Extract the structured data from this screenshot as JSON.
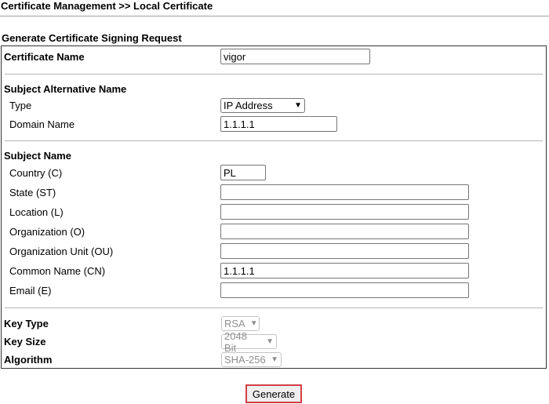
{
  "breadcrumb": "Certificate Management >> Local Certificate",
  "section_title": "Generate Certificate Signing Request",
  "certificate_name": {
    "label": "Certificate Name",
    "value": "vigor"
  },
  "san": {
    "heading": "Subject Alternative Name",
    "type_label": "Type",
    "type_value": "IP Address",
    "domain_label": "Domain Name",
    "domain_value": "1.1.1.1"
  },
  "subject": {
    "heading": "Subject Name",
    "country_label": "Country (C)",
    "country_value": "PL",
    "state_label": "State (ST)",
    "state_value": "",
    "location_label": "Location (L)",
    "location_value": "",
    "org_label": "Organization (O)",
    "org_value": "",
    "ou_label": "Organization Unit (OU)",
    "ou_value": "",
    "cn_label": "Common Name (CN)",
    "cn_value": "1.1.1.1",
    "email_label": "Email (E)",
    "email_value": ""
  },
  "key": {
    "type_label": "Key Type",
    "type_value": "RSA",
    "size_label": "Key Size",
    "size_value": "2048 Bit",
    "algo_label": "Algorithm",
    "algo_value": "SHA-256"
  },
  "generate_label": "Generate",
  "colors": {
    "generate_border": "#d33f46"
  }
}
